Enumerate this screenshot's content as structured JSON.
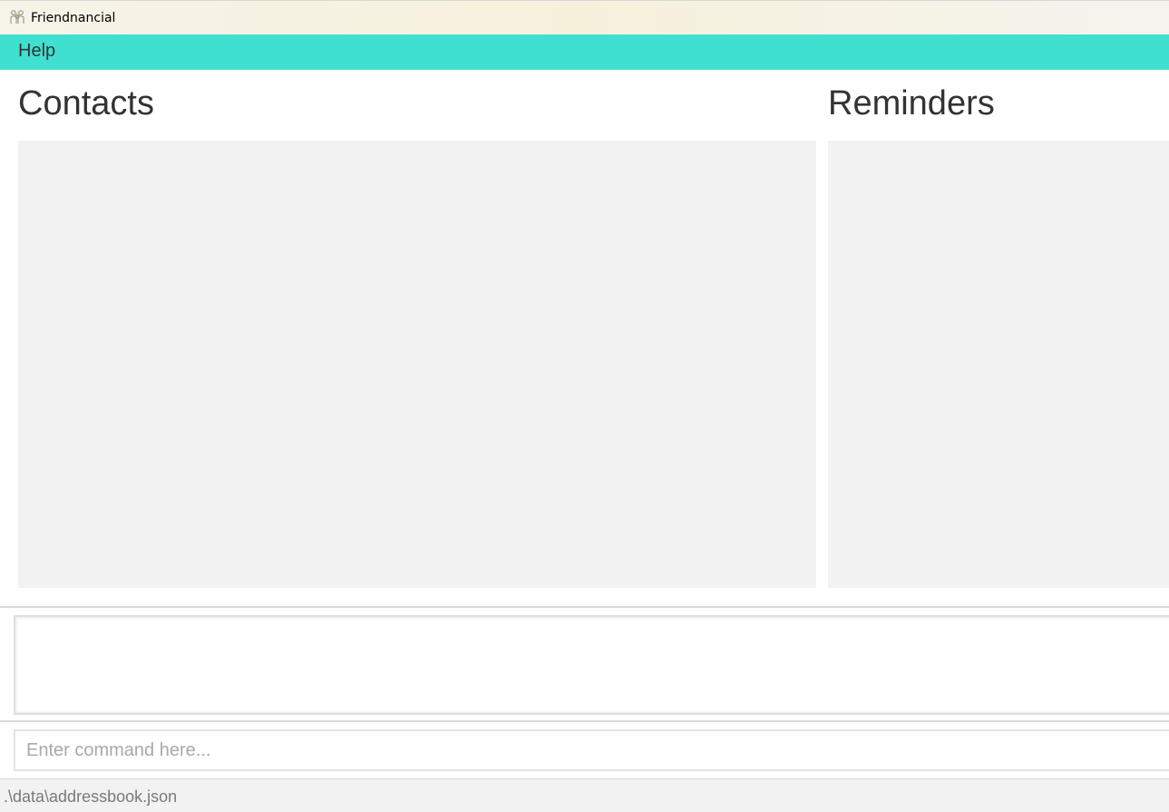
{
  "window": {
    "title": "Friendnancial",
    "icon": "people-icon"
  },
  "menu": {
    "items": [
      {
        "label": "Help"
      }
    ]
  },
  "contacts": {
    "title": "Contacts",
    "items": []
  },
  "reminders": {
    "title": "Reminders",
    "items": []
  },
  "result_display": {
    "text": ""
  },
  "command_box": {
    "value": "",
    "placeholder": "Enter command here..."
  },
  "status_bar": {
    "file_path": ".\\data\\addressbook.json"
  },
  "colors": {
    "menu_bar": "#40e0d0",
    "panel_bg": "#f2f2f2",
    "heading_text": "#333333"
  }
}
